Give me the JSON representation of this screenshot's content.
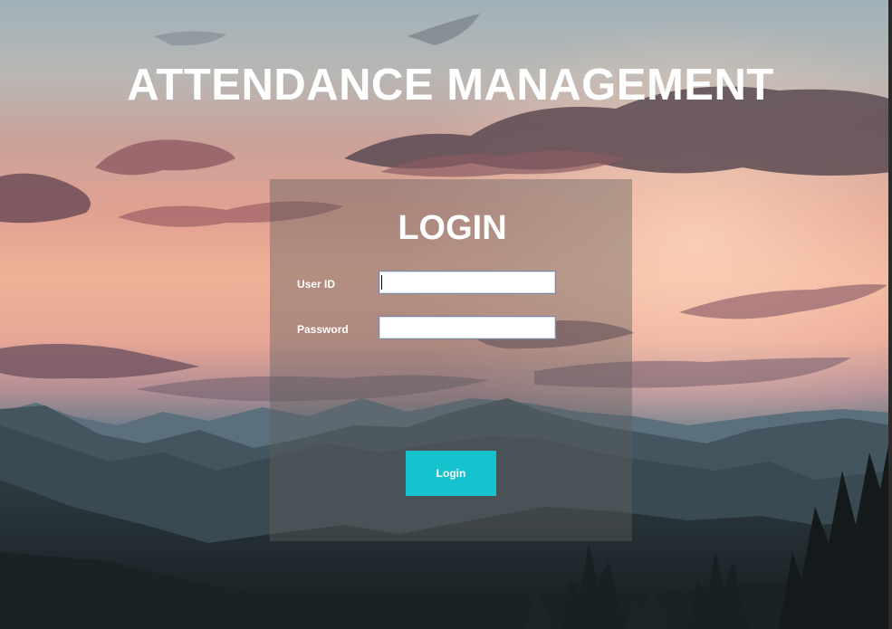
{
  "app": {
    "title": "ATTENDANCE MANAGEMENT"
  },
  "login": {
    "heading": "LOGIN",
    "user_id_label": "User ID",
    "user_id_value": "",
    "password_label": "Password",
    "password_value": "",
    "button_label": "Login"
  },
  "colors": {
    "button_bg": "#17c2cf",
    "text": "#ffffff"
  }
}
